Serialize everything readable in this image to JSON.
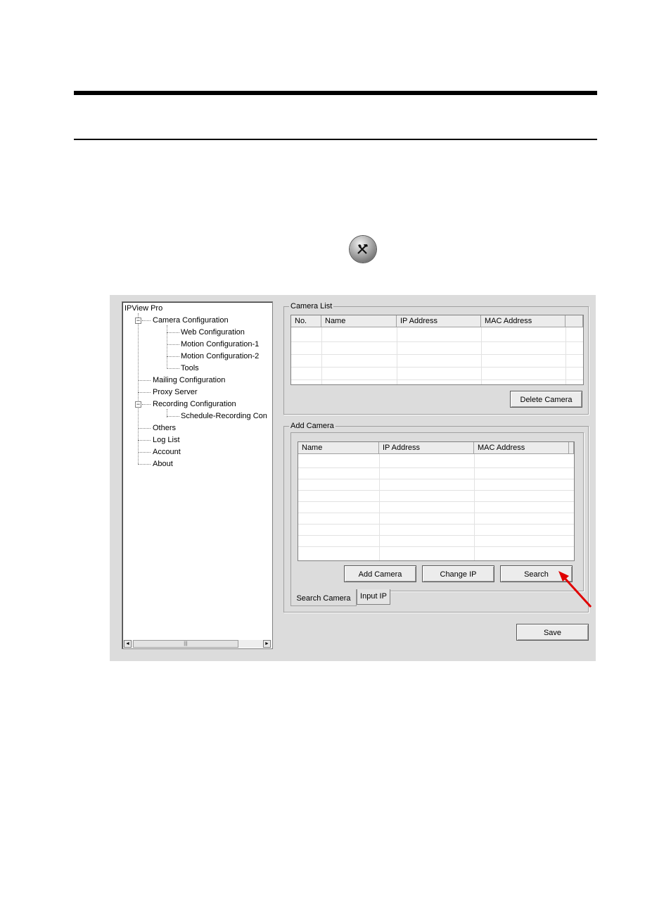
{
  "tree": {
    "root": "IPView Pro",
    "items": [
      {
        "label": "Camera Configuration"
      },
      {
        "label": "Web Configuration"
      },
      {
        "label": "Motion Configuration-1"
      },
      {
        "label": "Motion Configuration-2"
      },
      {
        "label": "Tools"
      },
      {
        "label": "Mailing Configuration"
      },
      {
        "label": "Proxy Server"
      },
      {
        "label": "Recording Configuration"
      },
      {
        "label": "Schedule-Recording Con"
      },
      {
        "label": "Others"
      },
      {
        "label": "Log List"
      },
      {
        "label": "Account"
      },
      {
        "label": "About"
      }
    ],
    "expander_symbol": "−",
    "scroll_left": "◄",
    "scroll_right": "►",
    "scroll_thumb_grip": "|||"
  },
  "camera_list": {
    "title": "Camera List",
    "columns": [
      "No.",
      "Name",
      "IP Address",
      "MAC Address"
    ],
    "delete_button": "Delete Camera"
  },
  "add_camera": {
    "title": "Add Camera",
    "columns": [
      "Name",
      "IP Address",
      "MAC Address"
    ],
    "add_button": "Add Camera",
    "change_ip_button": "Change IP",
    "search_button": "Search",
    "tabs": [
      "Search Camera",
      "Input IP"
    ]
  },
  "save_button": "Save",
  "icons": {
    "tool_icon": "tools-icon",
    "arrow": "red-arrow-icon"
  },
  "colors": {
    "arrow": "#e00000",
    "window_bg": "#dcdcdc"
  }
}
